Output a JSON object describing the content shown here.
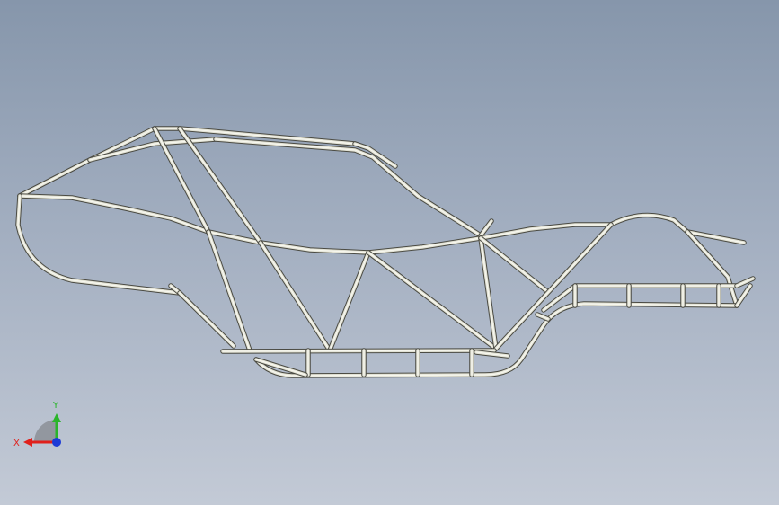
{
  "view": {
    "background_top": "#8696ab",
    "background_bottom": "#c3cad6",
    "tube_color": "#e3e3d6",
    "tube_outline": "#4a4a42"
  },
  "triad": {
    "x_label": "X",
    "y_label": "Y",
    "x_color": "#e0201c",
    "y_color": "#2ab52a",
    "z_color": "#1c3ad6"
  }
}
